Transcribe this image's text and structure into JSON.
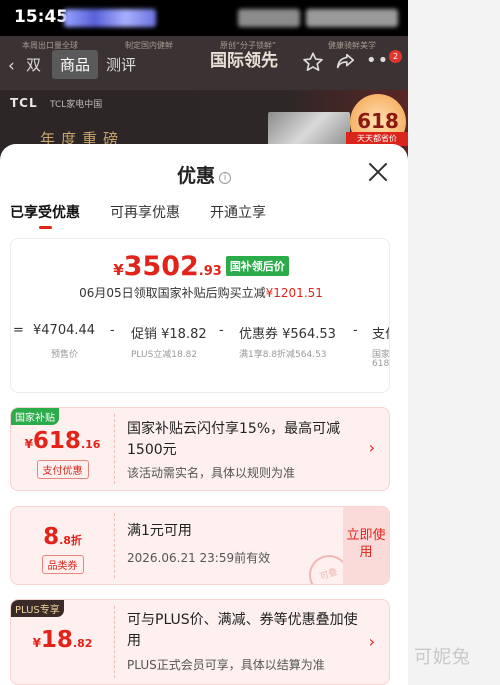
{
  "status_bar": {
    "time": "15:45"
  },
  "background_page": {
    "top_banners": [
      "本周出口量全球",
      "制定国内健鲜",
      "原创“分子锁鲜”",
      "健康骑鲜美学"
    ],
    "nav_tabs": [
      "双",
      "商品",
      "测评"
    ],
    "badge_text": "国际领先",
    "message_count": "2",
    "brand_logo": "TCL",
    "brand_subtitle": "TCL家电中国",
    "year_tag": "年度重磅",
    "sale_badge": "618",
    "sale_ribbon": "天天都省价"
  },
  "sheet": {
    "title": "优惠",
    "info_icon": "i",
    "tabs": [
      {
        "label": "已享受优惠",
        "active": true
      },
      {
        "label": "可再享优惠",
        "active": false
      },
      {
        "label": "开通立享",
        "active": false
      }
    ],
    "price_card": {
      "currency": "¥",
      "price_int": "3502",
      "price_dec": ".93",
      "price_tag": "国补领后价",
      "note_prefix": "06月05日领取国家补贴后购买立减",
      "note_amount": "¥1201.51",
      "formula": {
        "eq": "=",
        "minus": "-",
        "list_price": "¥4704.44",
        "list_price_label": "预售价",
        "plus_discount": "促销 ¥18.82",
        "plus_discount_label": "PLUS立减18.82",
        "coupon_discount": "优惠券 ¥564.53",
        "coupon_discount_label": "满1享8.8折减564.53",
        "payment": "支付",
        "payment_label": "国家",
        "payment_label2": "618"
      }
    },
    "coupons": [
      {
        "label": "国家补贴",
        "currency": "¥",
        "amount_int": "618",
        "amount_dec": ".16",
        "chip": "支付优惠",
        "title": "国家补贴云闪付享15%，最高可减1500元",
        "desc": "该活动需实名，具体以规则为准",
        "arrow": "›"
      },
      {
        "amount_int": "8",
        "amount_dec": ".8折",
        "chip": "品类券",
        "title": "满1元可用",
        "desc": "2026.06.21 23:59前有效",
        "button": "立即使用",
        "stamp": "可叠"
      },
      {
        "label": "PLUS专享",
        "currency": "¥",
        "amount_int": "18",
        "amount_dec": ".82",
        "title": "可与PLUS价、满减、券等优惠叠加使用",
        "desc": "PLUS正式会员可享，具体以结算为准",
        "arrow": "›"
      }
    ]
  },
  "watermark": "可妮兔",
  "colors": {
    "accent_red": "#e2231a",
    "green_tag": "#2bab4a",
    "coupon_bg": "#fdf0ef"
  }
}
